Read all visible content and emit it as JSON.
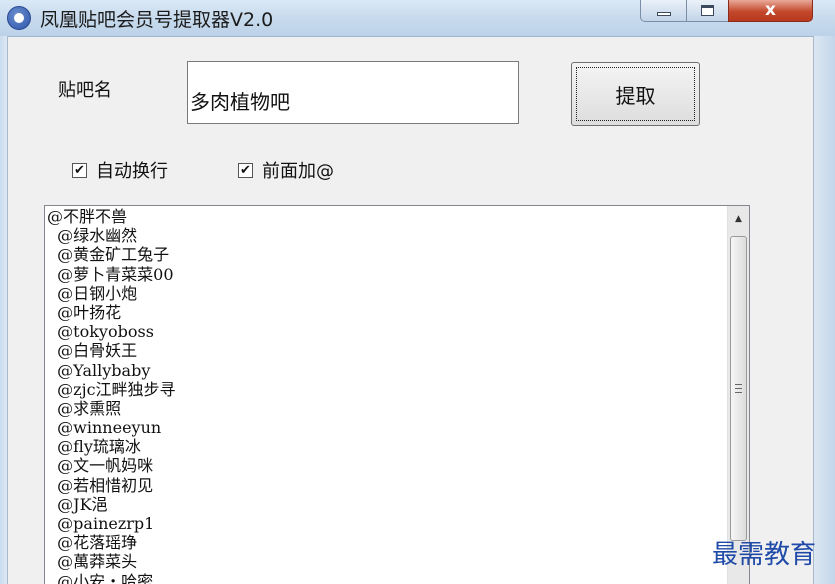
{
  "window": {
    "title": "凤凰贴吧会员号提取器V2.0",
    "close_label": "x"
  },
  "form": {
    "name_label": "贴吧名",
    "name_value": "多肉植物吧",
    "extract_label": "提取"
  },
  "options": [
    {
      "label": "自动换行",
      "checked": true,
      "mark": "✔"
    },
    {
      "label": "前面加@",
      "checked": true,
      "mark": "✔"
    }
  ],
  "results": [
    "@不胖不兽",
    "  @绿水幽然",
    "  @黄金矿工兔子",
    "  @萝卜青菜菜00",
    "  @日钢小炮",
    "  @叶扬花",
    "  @tokyoboss",
    "  @白骨妖王",
    "  @Yallybaby",
    "  @zjc江畔独步寻",
    "  @求熏照",
    "  @winneeyun",
    "  @fly琉璃冰",
    "  @文一帆妈咪",
    "  @若相惜初见",
    "  @JK浥",
    "  @painezrp1",
    "  @花落瑶琤",
    "  @萬莽菜头",
    "  @小安・哈密"
  ],
  "scrollbar": {
    "up_arrow": "▲"
  },
  "watermark": "最需教育"
}
